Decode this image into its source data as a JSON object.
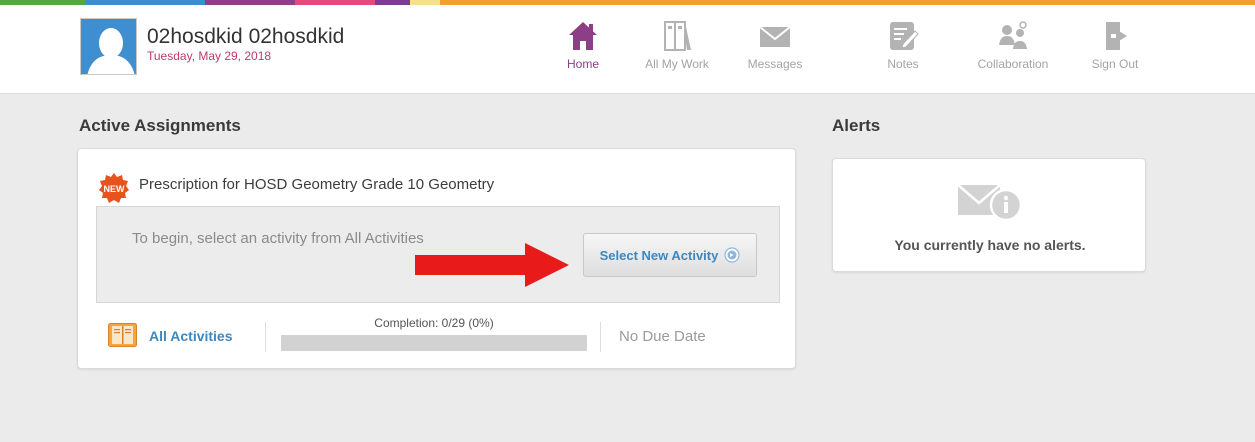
{
  "stripe_colors": [
    "#5aa444",
    "#3b8fd0",
    "#8c3e86",
    "#e8487b",
    "#7d3c8e",
    "#f5e18a",
    "#f0a12d"
  ],
  "colors": {
    "nav_active": "#8c3e86",
    "nav_inactive": "#a3a3a3",
    "link": "#3d87be",
    "date": "#c0396b",
    "alert_arrow": "#e81a1a"
  },
  "user": {
    "name": "02hosdkid 02hosdkid",
    "date": "Tuesday, May 29, 2018"
  },
  "nav": [
    {
      "label": "Home",
      "icon": "home-icon",
      "active": true
    },
    {
      "label": "All My Work",
      "icon": "books-icon",
      "active": false
    },
    {
      "label": "Messages",
      "icon": "envelope-icon",
      "active": false
    },
    {
      "label": "Notes",
      "icon": "notepad-icon",
      "active": false
    },
    {
      "label": "Collaboration",
      "icon": "collaboration-icon",
      "active": false
    },
    {
      "label": "Sign Out",
      "icon": "sign-out-icon",
      "active": false
    }
  ],
  "assignments": {
    "heading": "Active Assignments",
    "badge": "NEW",
    "title": "Prescription for HOSD Geometry Grade 10 Geometry",
    "instruction": "To begin, select an activity from All Activities",
    "button_label": "Select New Activity",
    "all_activities_label": "All Activities",
    "completion_label": "Completion: 0/29 (0%)",
    "completion_fraction": 0,
    "due_date": "No Due Date"
  },
  "alerts": {
    "heading": "Alerts",
    "message": "You currently have no alerts."
  }
}
